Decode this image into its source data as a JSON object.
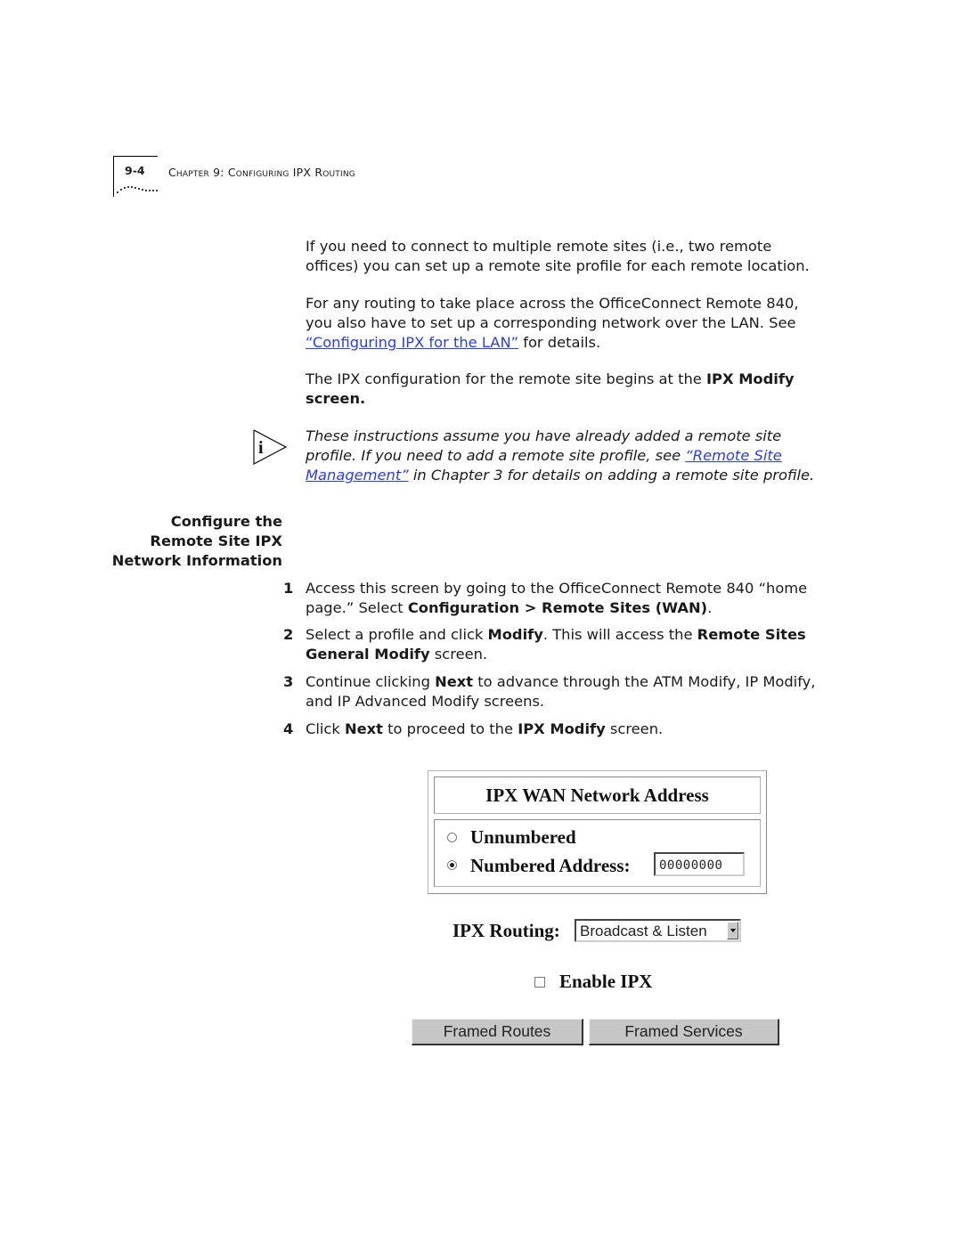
{
  "header": {
    "page_number": "9-4",
    "chapter_label": "Chapter 9: Configuring IPX Routing"
  },
  "paragraphs": {
    "p1": "If you need to connect to multiple remote sites (i.e., two remote offices) you can set up a remote site profile for each remote location.",
    "p2_pre": "For any routing to take place across the OfficeConnect Remote 840, you also have to set up a corresponding network over the LAN. See ",
    "p2_link": "“Configuring IPX for the LAN”",
    "p2_post": " for details.",
    "p3_pre": "The IPX configuration for the remote site begins at the ",
    "p3_bold": "IPX Modify screen."
  },
  "note": {
    "icon": "info-icon",
    "pre": "These instructions assume you have already added a remote site profile. If you need to add a remote site profile, see ",
    "link": "“Remote Site Management”",
    "post": " in Chapter 3 for details on adding a remote site profile."
  },
  "section": {
    "heading_line1": "Configure the",
    "heading_line2": "Remote Site IPX",
    "heading_line3": "Network Information"
  },
  "steps": [
    {
      "num": "1",
      "t1": "Access this screen by going to the OfficeConnect Remote 840 “home page.” Select ",
      "b1": "Configuration > Remote Sites (WAN)",
      "t2": "."
    },
    {
      "num": "2",
      "t1": "Select a profile and click ",
      "b1": "Modify",
      "t2": ". This will access the ",
      "b2": "Remote Sites General Modify",
      "t3": " screen."
    },
    {
      "num": "3",
      "t1": "Continue clicking ",
      "b1": "Next",
      "t2": " to advance through the ATM Modify, IP Modify, and IP Advanced Modify screens."
    },
    {
      "num": "4",
      "t1": "Click ",
      "b1": "Next",
      "t2": " to proceed to the ",
      "b2": "IPX Modify",
      "t3": " screen."
    }
  ],
  "screen": {
    "wan_title": "IPX WAN Network Address",
    "options": [
      {
        "label": "Unnumbered",
        "selected": false
      },
      {
        "label": "Numbered Address:",
        "selected": true
      }
    ],
    "address_value": "00000000",
    "routing_label": "IPX Routing:",
    "routing_value": "Broadcast & Listen",
    "enable_label": "Enable IPX",
    "enable_checked": false,
    "buttons": {
      "framed_routes": "Framed Routes",
      "framed_services": "Framed Services"
    }
  }
}
